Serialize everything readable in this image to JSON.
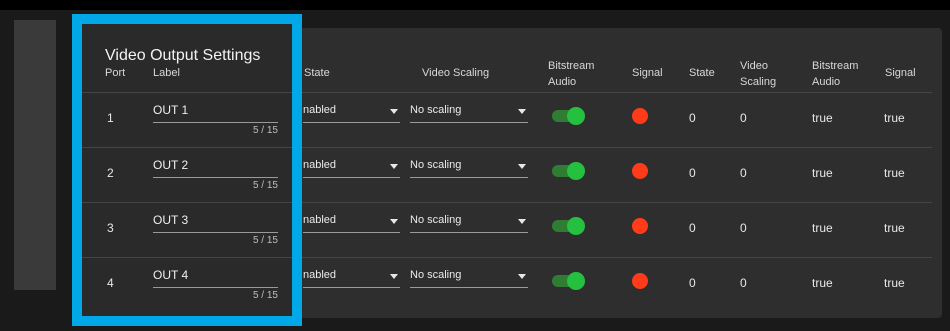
{
  "panel": {
    "title": "Video Output Settings"
  },
  "headers": {
    "port": "Port",
    "label": "Label",
    "state": "State",
    "video_scaling": "Video Scaling",
    "bitstream_audio": [
      "Bitstream",
      "Audio"
    ],
    "signal": "Signal",
    "state2": "State",
    "video_scaling2": [
      "Video",
      "Scaling"
    ],
    "bitstream_audio2": [
      "Bitstream",
      "Audio"
    ],
    "signal2": "Signal"
  },
  "rows": [
    {
      "port": "1",
      "label": "OUT 1",
      "count": "5 / 15",
      "state": "nabled",
      "scaling": "No scaling",
      "bitstream_on": true,
      "state_val": "0",
      "scaling_val": "0",
      "bitstream_val": "true",
      "signal_val": "true"
    },
    {
      "port": "2",
      "label": "OUT 2",
      "count": "5 / 15",
      "state": "nabled",
      "scaling": "No scaling",
      "bitstream_on": true,
      "state_val": "0",
      "scaling_val": "0",
      "bitstream_val": "true",
      "signal_val": "true"
    },
    {
      "port": "3",
      "label": "OUT 3",
      "count": "5 / 15",
      "state": "nabled",
      "scaling": "No scaling",
      "bitstream_on": true,
      "state_val": "0",
      "scaling_val": "0",
      "bitstream_val": "true",
      "signal_val": "true"
    },
    {
      "port": "4",
      "label": "OUT 4",
      "count": "5 / 15",
      "state": "nabled",
      "scaling": "No scaling",
      "bitstream_on": true,
      "state_val": "0",
      "scaling_val": "0",
      "bitstream_val": "true",
      "signal_val": "true"
    }
  ],
  "colors": {
    "highlight": "#00a8e8",
    "toggle_on": "#26c040",
    "signal_dot": "#ff3b1a"
  }
}
